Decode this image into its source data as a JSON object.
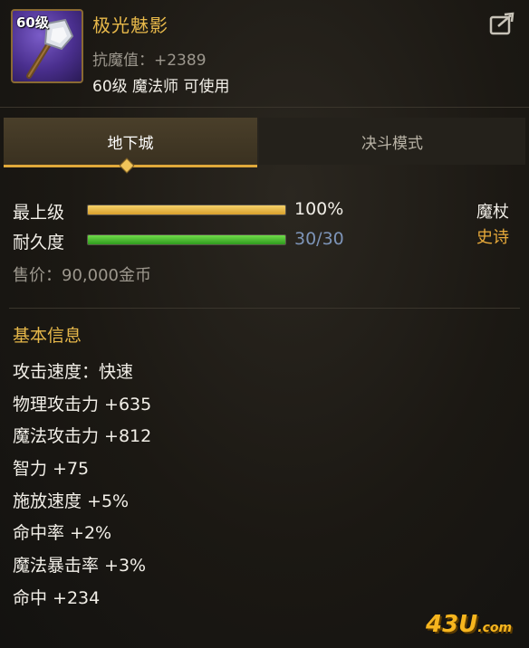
{
  "item": {
    "level_badge": "60级",
    "name": "极光魅影",
    "resist": "抗魔值：+2389",
    "requirement": "60级 魔法师 可使用",
    "weapon_type": "魔杖",
    "rarity": "史诗",
    "price": "售价：90,000金币"
  },
  "tabs": [
    {
      "label": "地下城",
      "active": true
    },
    {
      "label": "决斗模式",
      "active": false
    }
  ],
  "bars": {
    "upgrade": {
      "label": "最上级",
      "value_text": "100%",
      "fraction": 1.0
    },
    "durability": {
      "label": "耐久度",
      "value_text": "30/30",
      "fraction": 1.0
    }
  },
  "basic_info": {
    "title": "基本信息",
    "attributes": [
      "攻击速度：快速",
      "物理攻击力 +635",
      "魔法攻击力 +812",
      "智力 +75",
      "施放速度 +5%",
      "命中率 +2%",
      "魔法暴击率 +3%",
      "命中 +234"
    ]
  },
  "watermark": {
    "main": "43U",
    "suffix": ".com"
  },
  "icons": [
    "staff-icon",
    "share-icon",
    "tab-indicator-icon"
  ],
  "colors": {
    "gold": "#e7b84a",
    "rarity_epic": "#e7a93a",
    "bar_gold": "#d9a02c",
    "bar_green": "#2f9a1e"
  }
}
